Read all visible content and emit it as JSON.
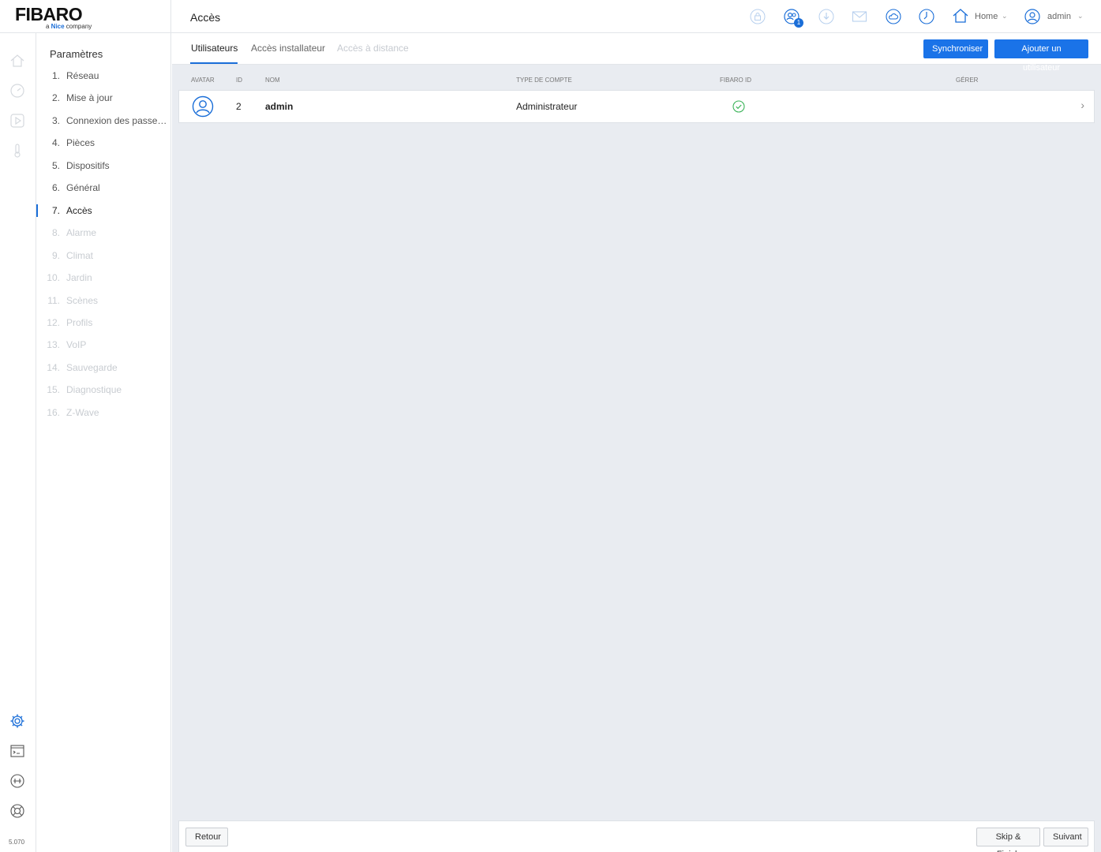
{
  "brand": {
    "logo": "FIBARO",
    "tagline_pre": "a ",
    "tagline_brand": "Nice",
    "tagline_post": " company"
  },
  "header": {
    "title": "Accès",
    "notification_badge": "1",
    "home_label": "Home",
    "user_label": "admin"
  },
  "rail": {
    "version": "5.070"
  },
  "settings_nav": {
    "title": "Paramètres",
    "items": [
      {
        "num": "1.",
        "label": "Réseau",
        "state": "done"
      },
      {
        "num": "2.",
        "label": "Mise à jour",
        "state": "done"
      },
      {
        "num": "3.",
        "label": "Connexion des passerelles",
        "state": "done"
      },
      {
        "num": "4.",
        "label": "Pièces",
        "state": "done"
      },
      {
        "num": "5.",
        "label": "Dispositifs",
        "state": "done"
      },
      {
        "num": "6.",
        "label": "Général",
        "state": "done"
      },
      {
        "num": "7.",
        "label": "Accès",
        "state": "active"
      },
      {
        "num": "8.",
        "label": "Alarme",
        "state": "disabled"
      },
      {
        "num": "9.",
        "label": "Climat",
        "state": "disabled"
      },
      {
        "num": "10.",
        "label": "Jardin",
        "state": "disabled"
      },
      {
        "num": "11.",
        "label": "Scènes",
        "state": "disabled"
      },
      {
        "num": "12.",
        "label": "Profils",
        "state": "disabled"
      },
      {
        "num": "13.",
        "label": "VoIP",
        "state": "disabled"
      },
      {
        "num": "14.",
        "label": "Sauvegarde",
        "state": "disabled"
      },
      {
        "num": "15.",
        "label": "Diagnostique",
        "state": "disabled"
      },
      {
        "num": "16.",
        "label": "Z-Wave",
        "state": "disabled"
      }
    ]
  },
  "tabs": {
    "users": "Utilisateurs",
    "installer": "Accès installateur",
    "remote": "Accès à distance"
  },
  "actions": {
    "sync": "Synchroniser",
    "add_user": "Ajouter un utilisateur"
  },
  "table": {
    "headers": {
      "avatar": "Avatar",
      "id": "ID",
      "name": "Nom",
      "account_type": "Type de compte",
      "fibaro_id": "Fibaro ID",
      "manage": "Gérer"
    },
    "rows": [
      {
        "id": "2",
        "name": "admin",
        "account_type": "Administrateur",
        "fibaro_id_linked": true
      }
    ]
  },
  "footer": {
    "back": "Retour",
    "skip": "Skip & Finish",
    "next": "Suivant"
  },
  "colors": {
    "accent": "#1a73e8",
    "success": "#3cb45a",
    "disabled_text": "#c8ccd1",
    "content_bg": "#e9ecf1"
  },
  "icons": [
    "home-icon",
    "dashboard-icon",
    "scenes-icon",
    "climate-icon",
    "settings-gear-icon",
    "console-icon",
    "integrations-icon",
    "support-lifebuoy-icon",
    "lock-icon",
    "users-icon",
    "download-icon",
    "mail-icon",
    "weather-icon",
    "clock-icon",
    "user-avatar-icon",
    "check-circle-icon",
    "chevron-right-icon"
  ]
}
